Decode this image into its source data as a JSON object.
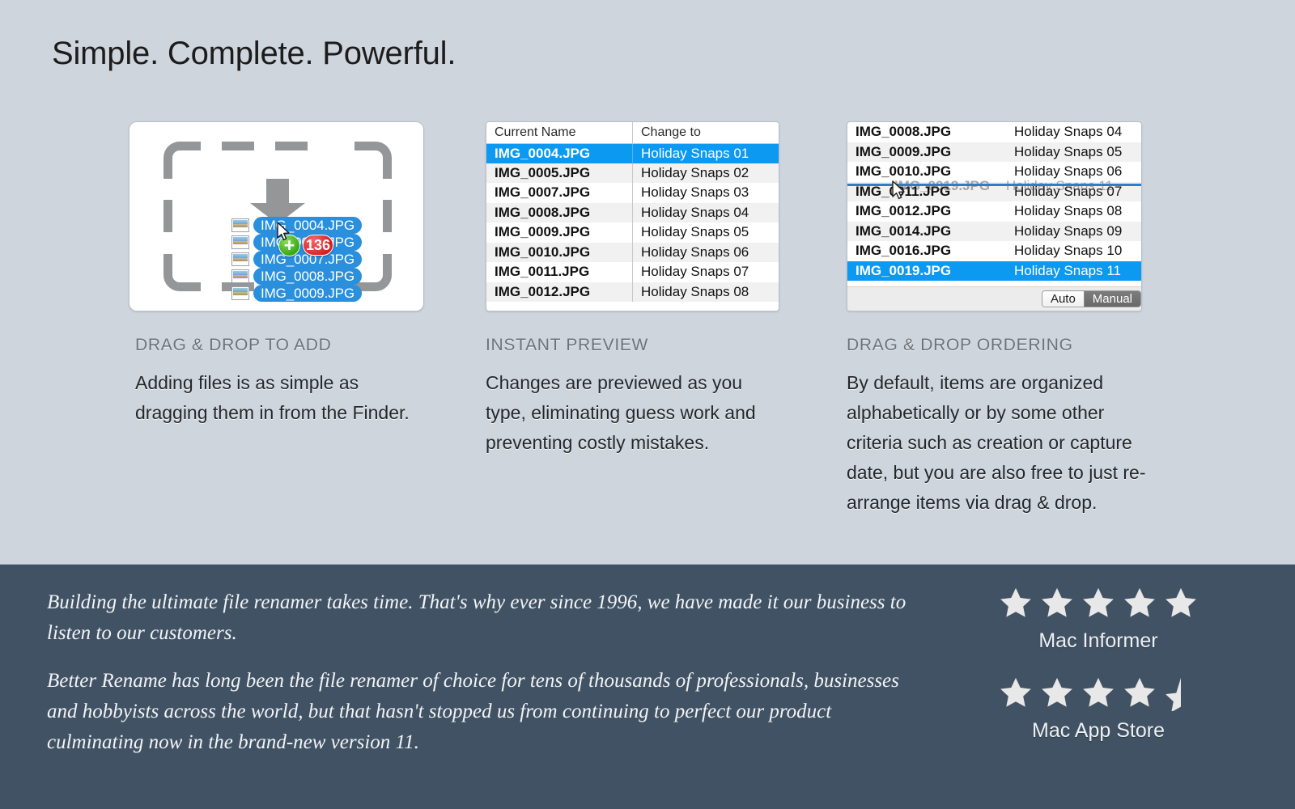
{
  "headline": "Simple. Complete. Powerful.",
  "colors": {
    "page_background": "#ced5dd",
    "footer_background": "#415264",
    "selection_blue": "#0b99f2",
    "drop_line_blue": "#2f7dc4",
    "badge_green": "#37a915",
    "badge_red": "#d92020"
  },
  "features": [
    {
      "title": "DRAG & DROP TO ADD",
      "body": "Adding files is as simple as dragging them in from the Finder.",
      "dropzone": {
        "arrow_icon": "download-arrow-icon",
        "cursor_icon": "mouse-pointer-icon",
        "plus_badge": "+",
        "count_badge": "136",
        "files": [
          "IMG_0004.JPG",
          "IMG_0005.JPG",
          "IMG_0007.JPG",
          "IMG_0008.JPG",
          "IMG_0009.JPG"
        ]
      }
    },
    {
      "title": "INSTANT PREVIEW",
      "body": "Changes are previewed as you type, eliminating guess work and preventing costly mistakes.",
      "table": {
        "columns": [
          "Current Name",
          "Change to"
        ],
        "rows": [
          {
            "current": "IMG_0004.JPG",
            "change_to": "Holiday Snaps 01",
            "selected": true
          },
          {
            "current": "IMG_0005.JPG",
            "change_to": "Holiday Snaps 02",
            "selected": false
          },
          {
            "current": "IMG_0007.JPG",
            "change_to": "Holiday Snaps 03",
            "selected": false
          },
          {
            "current": "IMG_0008.JPG",
            "change_to": "Holiday Snaps 04",
            "selected": false
          },
          {
            "current": "IMG_0009.JPG",
            "change_to": "Holiday Snaps 05",
            "selected": false
          },
          {
            "current": "IMG_0010.JPG",
            "change_to": "Holiday Snaps 06",
            "selected": false
          },
          {
            "current": "IMG_0011.JPG",
            "change_to": "Holiday Snaps 07",
            "selected": false
          },
          {
            "current": "IMG_0012.JPG",
            "change_to": "Holiday Snaps 08",
            "selected": false
          }
        ]
      }
    },
    {
      "title": "DRAG & DROP ORDERING",
      "body": "By default, items are organized alphabetically or by some other criteria such as creation or capture date, but you are also free to just re-arrange items via drag & drop.",
      "table": {
        "rows": [
          {
            "current": "IMG_0008.JPG",
            "change_to": "Holiday Snaps 04",
            "selected": false
          },
          {
            "current": "IMG_0009.JPG",
            "change_to": "Holiday Snaps 05",
            "selected": false
          },
          {
            "current": "IMG_0010.JPG",
            "change_to": "Holiday Snaps 06",
            "selected": false
          },
          {
            "current": "IMG_0011.JPG",
            "change_to": "Holiday Snaps 07",
            "selected": false
          },
          {
            "current": "IMG_0012.JPG",
            "change_to": "Holiday Snaps 08",
            "selected": false
          },
          {
            "current": "IMG_0014.JPG",
            "change_to": "Holiday Snaps 09",
            "selected": false
          },
          {
            "current": "IMG_0016.JPG",
            "change_to": "Holiday Snaps 10",
            "selected": false
          },
          {
            "current": "IMG_0019.JPG",
            "change_to": "Holiday Snaps 11",
            "selected": true
          }
        ],
        "drag_ghost": {
          "current": "IMG_0019.JPG",
          "change_to": "Holiday Snaps 11",
          "cursor_icon": "mouse-pointer-icon"
        },
        "footer_segment": {
          "options": [
            "Auto",
            "Manual"
          ],
          "selected": "Manual"
        }
      }
    }
  ],
  "footer": {
    "paragraphs": [
      "Building the ultimate file renamer takes time. That's why ever since 1996, we have made it our business to listen to our customers.",
      "Better Rename has long been the file renamer of choice for tens of thousands of professionals, businesses and hobbyists across the world, but that hasn't stopped us from continuing to perfect our product culminating now in the brand-new version 11."
    ],
    "ratings": [
      {
        "label": "Mac Informer",
        "stars": 5,
        "half": false
      },
      {
        "label": "Mac App Store",
        "stars": 4,
        "half": true
      }
    ]
  }
}
